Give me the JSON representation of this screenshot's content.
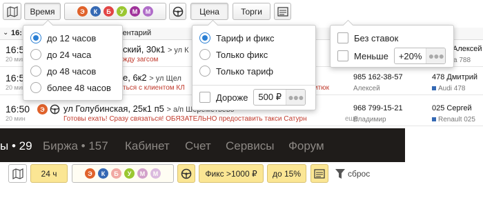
{
  "toolbar": {
    "time_label": "Время",
    "classes": [
      "Э",
      "К",
      "Б",
      "У",
      "М",
      "М"
    ],
    "price_label": "Цена",
    "bids_label": "Торги"
  },
  "table": {
    "header_sort": "16:",
    "header_comment": "ментарий",
    "rows": [
      {
        "time": "16:5",
        "ago": "20 мин",
        "addr": "ский, 30к1",
        "addr_to": "> ул К",
        "note": "жду загсом",
        "phone": "",
        "pname": "",
        "driver": "Алексей",
        "car": "а 788"
      },
      {
        "time": "16:5",
        "ago": "20 мин",
        "addr": "е, 6к2",
        "addr_to": "> ул Щел",
        "note": "ться с клиентом КЛ",
        "note_tail": "итюк",
        "phone": "985 162-38-57",
        "pname": "Алексей",
        "driver": "478 Дмитрий",
        "car": "Audi 478"
      },
      {
        "time": "16:50",
        "ago": "20 мин",
        "addr": "ул Голубинская, 25к1 п5",
        "addr_to": "> а/п Шереметьево",
        "note": "Готовы ехать! Сразу связаться! ОБЯЗАТЕЛЬНО предоставить такси Сатурн",
        "note_more": "ещё",
        "phone": "968 799-15-21",
        "pname": "Владимир",
        "driver": "025 Сергей",
        "car": "Renault 025"
      }
    ]
  },
  "time_popup": {
    "options": [
      "до 12 часов",
      "до 24 часа",
      "до 48 часов",
      "более 48 часов"
    ],
    "selected": 0
  },
  "price_popup": {
    "options": [
      "Тариф и фикс",
      "Только фикс",
      "Только тариф"
    ],
    "selected": 0,
    "more_label": "Дороже",
    "more_value": "500 ₽"
  },
  "bids_popup": {
    "no_bids_label": "Без ставок",
    "less_label": "Меньше",
    "less_value": "+20%"
  },
  "nav": {
    "items": [
      "ы • 29",
      "Биржа • 157",
      "Кабинет",
      "Счет",
      "Сервисы",
      "Форум"
    ],
    "current": 0
  },
  "filters": {
    "time": "24 ч",
    "classes": [
      "Э",
      "К",
      "Б",
      "У",
      "М",
      "М"
    ],
    "fix": "Фикс >1000 ₽",
    "upto": "до 15%",
    "reset": "сброс"
  },
  "colors": {
    "accent": "#2a7fd4",
    "yellow": "#fbe694",
    "nav_bg": "#1f1c1a",
    "note_red": "#c0392b"
  }
}
